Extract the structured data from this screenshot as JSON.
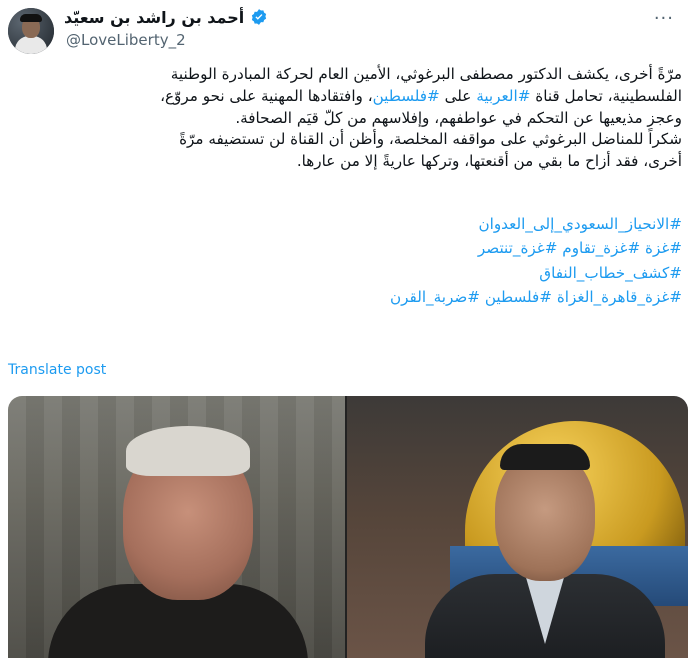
{
  "header": {
    "display_name": "أحمد بن راشد بن سعيّد",
    "handle": "@LoveLiberty_2",
    "more_label": "···"
  },
  "post": {
    "lines": [
      "مرّةً أخرى، يكشف الدكتور مصطفى البرغوثي، الأمين العام لحركة المبادرة الوطنية",
      "الفلسطينية، تحامل قناة #العربية على #فلسطين، وافتقادها المهنية على نحو مروّع،",
      "وعجز مذيعيها عن التحكم في عواطفهم، وإفلاسهم من كلّ قيَم الصحافة.",
      "شكراً للمناضل البرغوثي على مواقفه المخلصة، وأظن أن القناة لن تستضيفه مرّةً",
      "أخرى، فقد أزاح ما بقي من أقنعتها، وتركها عاريةً إلا من عارها."
    ],
    "hashtag_lines": [
      "#الانحياز_السعودي_إلى_العدوان",
      "#غزة #غزة_تقاوم #غزة_تنتصر",
      "#كشف_خطاب_النفاق",
      "#غزة_قاهرة_الغزاة #فلسطين #ضربة_القرن"
    ],
    "translate_label": "Translate post"
  },
  "colors": {
    "link": "#1d9bf0",
    "muted": "#536471",
    "text": "#0f1419"
  }
}
